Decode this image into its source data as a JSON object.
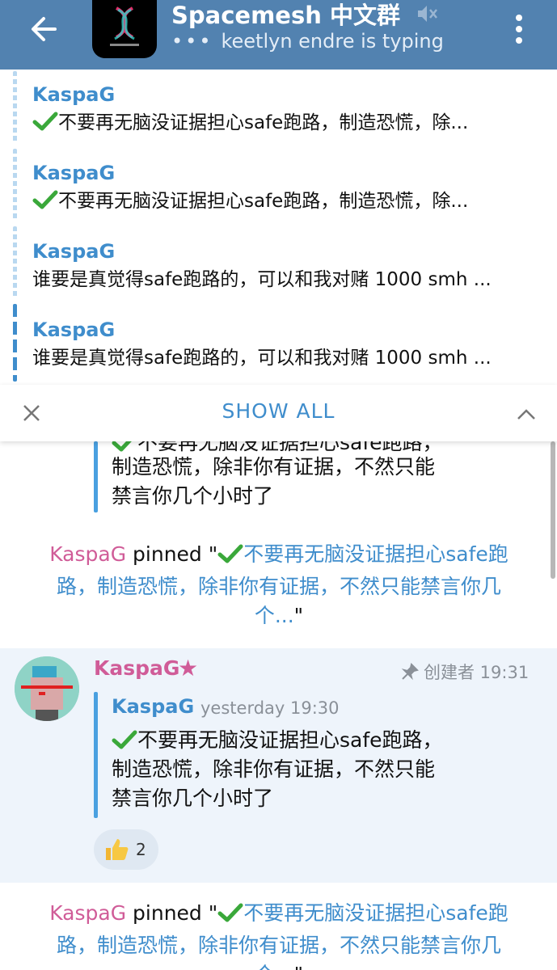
{
  "header": {
    "title": "Spacemesh 中文群",
    "status": "keetlyn endre is typing"
  },
  "pinned_list": {
    "items": [
      {
        "sender": "KaspaG",
        "text": "不要再无脑没证据担心safe跑路，制造恐慌，除..."
      },
      {
        "sender": "KaspaG",
        "text": "不要再无脑没证据担心safe跑路，制造恐慌，除..."
      },
      {
        "sender": "KaspaG",
        "text": "谁要是真觉得safe跑路的，可以和我对赌 1000 smh ..."
      },
      {
        "sender": "KaspaG",
        "text": "谁要是真觉得safe跑路的，可以和我对赌 1000 smh ..."
      }
    ],
    "show_all_label": "SHOW ALL"
  },
  "chat": {
    "top_quote_lines": [
      "不要再无脑没证据担心safe跑路，",
      "制造恐慌，除非你有证据，不然只能",
      "禁言你几个小时了"
    ],
    "service1": {
      "name": "KaspaG",
      "action": " pinned \"",
      "quote_l1": "不要再无脑没证据担心safe跑",
      "quote_l2": "路，制造恐慌，除非你有证据，不然只能禁言你几",
      "quote_l3": "个...",
      "end": "\""
    },
    "message": {
      "sender": "KaspaG",
      "role_time": "创建者 19:31",
      "reply_sender": "KaspaG",
      "reply_time": "yesterday 19:30",
      "lines": [
        "不要再无脑没证据担心safe跑路，",
        "制造恐慌，除非你有证据，不然只能",
        "禁言你几个小时了"
      ],
      "reaction_count": "2"
    },
    "service2": {
      "name": "KaspaG",
      "action": " pinned \"",
      "quote_l1": "不要再无脑没证据担心safe跑",
      "quote_l2": "路，制造恐慌，除非你有证据，不然只能禁言你几",
      "quote_l3": "个...",
      "end": "\""
    }
  }
}
